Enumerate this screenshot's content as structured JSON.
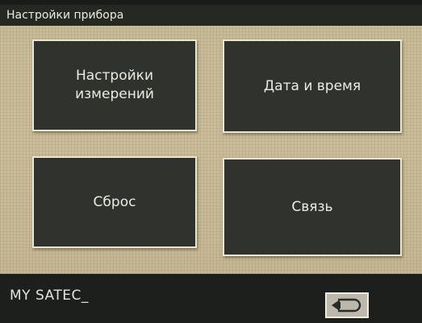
{
  "header": {
    "title": "Настройки прибора"
  },
  "menu": {
    "measurement_settings": {
      "line1": "Настройки",
      "line2": "измерений"
    },
    "date_time": "Дата и время",
    "reset": "Сброс",
    "communication": "Связь"
  },
  "footer": {
    "device_name": "MY SATEC_",
    "back_icon": "return-arrow-icon"
  },
  "colors": {
    "panel_background": "#c9bc98",
    "tile_background": "#30322d",
    "tile_border": "#ebe6d4",
    "status_bar": "#1c1f1b"
  }
}
